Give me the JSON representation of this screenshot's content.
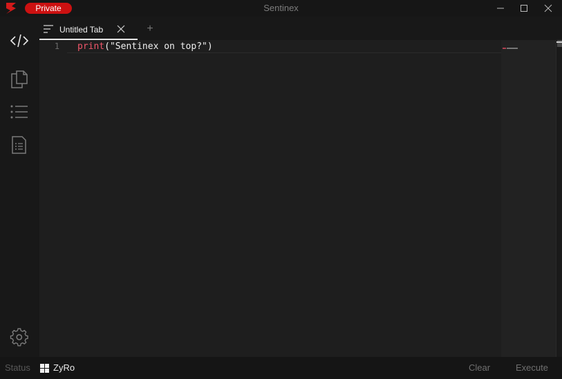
{
  "window": {
    "title": "Sentinex",
    "badge": "Private"
  },
  "sidebar": {
    "items": [
      {
        "name": "editor",
        "icon": "code-icon",
        "active": true
      },
      {
        "name": "files",
        "icon": "copy-icon"
      },
      {
        "name": "script-list",
        "icon": "list-icon"
      },
      {
        "name": "script-hub",
        "icon": "document-list-icon"
      },
      {
        "name": "settings",
        "icon": "gear-icon"
      }
    ]
  },
  "tabs": {
    "items": [
      {
        "label": "Untitled Tab"
      }
    ],
    "new_tab_label": "+"
  },
  "editor": {
    "line_numbers": [
      "1"
    ],
    "code_keyword": "print",
    "code_rest": "(\"Sentinex on top?\")"
  },
  "status": {
    "label": "Status",
    "user": "ZyRo",
    "clear_label": "Clear",
    "execute_label": "Execute"
  },
  "colors": {
    "accent": "#cc1111",
    "keyword": "#f0566a",
    "background": "#1e1e1e"
  }
}
